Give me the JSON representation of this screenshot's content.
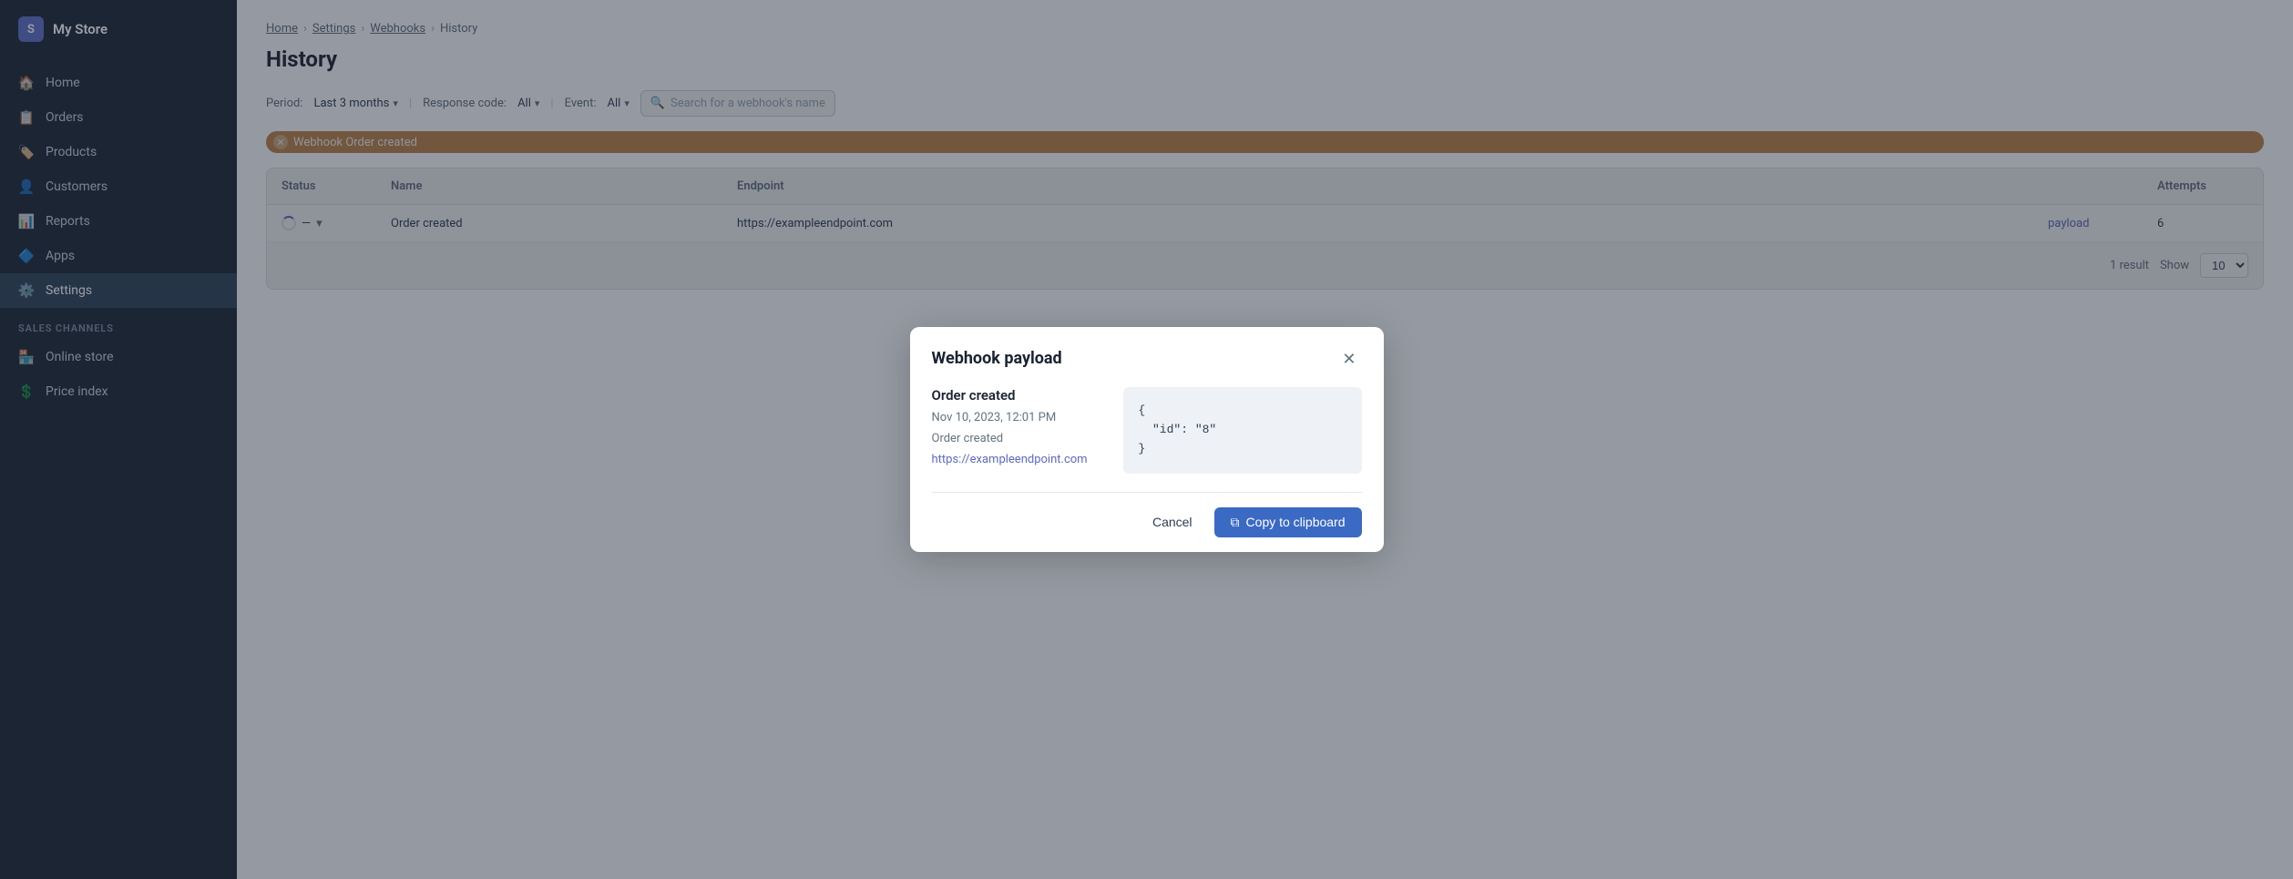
{
  "sidebar": {
    "logo_label": "My Store",
    "items": [
      {
        "id": "home",
        "label": "Home",
        "icon": "🏠",
        "active": false
      },
      {
        "id": "orders",
        "label": "Orders",
        "icon": "📋",
        "active": false
      },
      {
        "id": "products",
        "label": "Products",
        "icon": "🏷️",
        "active": false
      },
      {
        "id": "customers",
        "label": "Customers",
        "icon": "👤",
        "active": false
      },
      {
        "id": "reports",
        "label": "Reports",
        "icon": "📊",
        "active": false
      },
      {
        "id": "apps",
        "label": "Apps",
        "icon": "🔷",
        "active": false
      },
      {
        "id": "settings",
        "label": "Settings",
        "icon": "⚙️",
        "active": true
      }
    ],
    "sales_channels_label": "SALES CHANNELS",
    "sales_channel_items": [
      {
        "id": "online-store",
        "label": "Online store",
        "icon": "🏪"
      },
      {
        "id": "price-index",
        "label": "Price index",
        "icon": "💲"
      }
    ]
  },
  "breadcrumb": {
    "home": "Home",
    "settings": "Settings",
    "webhooks": "Webhooks",
    "current": "History"
  },
  "page": {
    "title": "History"
  },
  "filters": {
    "period_label": "Period:",
    "period_value": "Last 3 months",
    "response_code_label": "Response code:",
    "response_code_value": "All",
    "event_label": "Event:",
    "event_value": "All",
    "search_placeholder": "Search for a webhook's name"
  },
  "active_filter": {
    "label": "Webhook Order created"
  },
  "table": {
    "headers": [
      "Status",
      "Name",
      "",
      "Endpoint",
      "",
      "Attempts"
    ],
    "rows": [
      {
        "status": "—",
        "name": "Order created",
        "endpoint": "https://exampleendpoint.com",
        "attempts": "6",
        "payload_link": "payload"
      }
    ],
    "footer": {
      "result_count": "1 result",
      "show_label": "Show",
      "show_value": "10"
    }
  },
  "modal": {
    "title": "Webhook payload",
    "info": {
      "name": "Order created",
      "date": "Nov 10, 2023, 12:01 PM",
      "event": "Order created",
      "url": "https://exampleendpoint.com"
    },
    "code": "{\n  \"id\": \"8\"\n}",
    "cancel_label": "Cancel",
    "copy_label": "Copy to clipboard",
    "copy_icon": "⧉"
  }
}
